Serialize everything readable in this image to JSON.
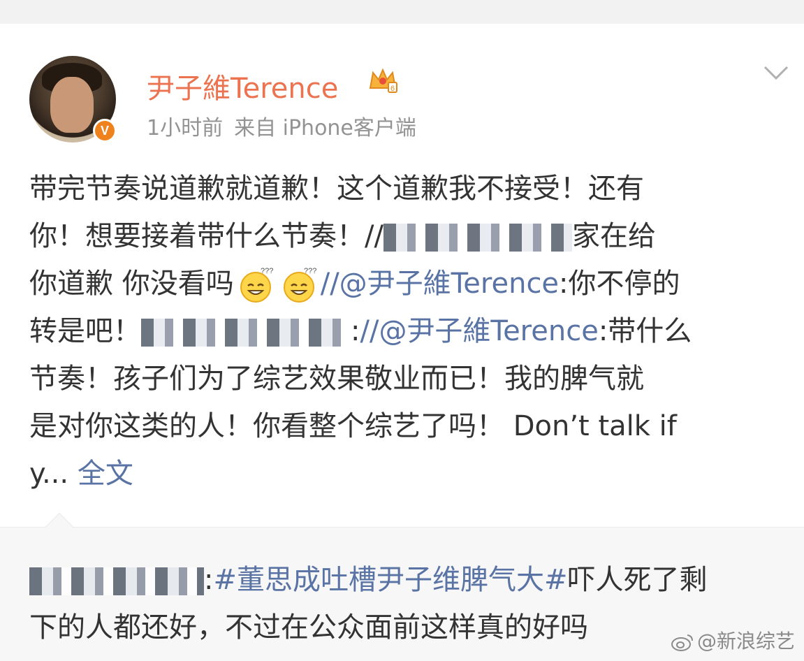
{
  "post": {
    "username": "尹子維Terence",
    "time": "1小时前",
    "source": "来自 iPhone客户端",
    "verified_mark": "V",
    "lines": [
      {
        "parts": [
          {
            "t": "text",
            "v": "带完节奏说道歉就道歉！这个道歉我不接受！还有"
          }
        ]
      },
      {
        "parts": [
          {
            "t": "text",
            "v": "你！想要接着带什么节奏！//"
          },
          {
            "t": "blur",
            "w": 270
          },
          {
            "t": "text",
            "v": "家在给"
          }
        ]
      },
      {
        "parts": [
          {
            "t": "text",
            "v": "你道歉 你没看吗"
          },
          {
            "t": "emoji"
          },
          {
            "t": "emoji"
          },
          {
            "t": "link",
            "v": "//@尹子維Terence"
          },
          {
            "t": "text",
            "v": ":你不停的"
          }
        ]
      },
      {
        "parts": [
          {
            "t": "text",
            "v": "转是吧！"
          },
          {
            "t": "blur",
            "w": 300
          },
          {
            "t": "text",
            "v": ":"
          },
          {
            "t": "link",
            "v": "//@尹子維Terence"
          },
          {
            "t": "text",
            "v": ":带什么"
          }
        ]
      },
      {
        "parts": [
          {
            "t": "text",
            "v": "节奏！孩子们为了综艺效果敬业而已！我的脾气就"
          }
        ]
      },
      {
        "parts": [
          {
            "t": "text",
            "v": "是对你这类的人！你看整个综艺了吗！ Don’t talk if"
          }
        ]
      },
      {
        "parts": [
          {
            "t": "text",
            "v": "y... "
          },
          {
            "t": "link",
            "v": "全文"
          }
        ]
      }
    ]
  },
  "repost": {
    "lines": [
      {
        "parts": [
          {
            "t": "blur",
            "w": 250
          },
          {
            "t": "text",
            "v": ":"
          },
          {
            "t": "topic",
            "v": "#董思成吐槽尹子维脾气大#"
          },
          {
            "t": "text",
            "v": "吓人死了剩"
          }
        ]
      },
      {
        "parts": [
          {
            "t": "text",
            "v": "下的人都还好，不过在公众面前这样真的好吗"
          }
        ]
      }
    ]
  },
  "watermark": "@新浪综艺",
  "icons": {
    "avatar": "user-avatar",
    "verified": "verified-badge-icon",
    "vip": "vip-crown-icon",
    "menu": "chevron-down-icon",
    "emoji": "dizzy-smile-emoji-icon",
    "weibo_logo": "weibo-logo-icon"
  },
  "colors": {
    "username": "#eb7350",
    "link": "#5a73a5",
    "meta": "#939393",
    "verified": "#f0821e"
  }
}
